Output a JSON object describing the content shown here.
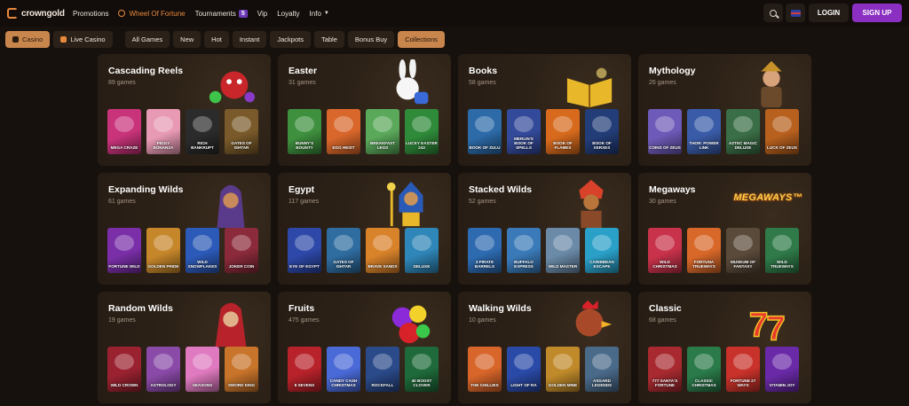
{
  "brand": {
    "name": "crowngold",
    "accent": "#e8893c"
  },
  "nav": {
    "items": [
      {
        "label": "Promotions"
      },
      {
        "label": "Wheel Of Fortune",
        "icon": "wheel-icon"
      },
      {
        "label": "Tournaments",
        "badge": "5"
      },
      {
        "label": "Vip"
      },
      {
        "label": "Loyalty"
      },
      {
        "label": "Info",
        "icon": "chevron-down-icon"
      }
    ]
  },
  "header_actions": {
    "login": "LOGIN",
    "signup": "SIGN UP",
    "signup_color": "#8a2fc2"
  },
  "filters": {
    "main": [
      {
        "label": "Casino",
        "active": true
      },
      {
        "label": "Live Casino",
        "active": false
      }
    ],
    "categories": [
      "All Games",
      "New",
      "Hot",
      "Instant",
      "Jackpots",
      "Table",
      "Bonus Buy",
      "Collections"
    ],
    "active_category": "Collections"
  },
  "collections": [
    {
      "title": "Cascading Reels",
      "count": "89 games",
      "art": "red-dragon",
      "games": [
        {
          "name": "MEGA CRAZE",
          "color": "#c9337a"
        },
        {
          "name": "PIGGY BONANZA",
          "color": "#e89ab4"
        },
        {
          "name": "RICH BANKRUPT",
          "color": "#2b2b2b"
        },
        {
          "name": "GATES OF ISHTAR",
          "color": "#7a5a2a"
        }
      ]
    },
    {
      "title": "Easter",
      "count": "31 games",
      "art": "white-bunny",
      "games": [
        {
          "name": "BUNNY'S BOUNTY",
          "color": "#3e8f3e"
        },
        {
          "name": "EGG HEIST",
          "color": "#d9672b"
        },
        {
          "name": "BREAKFAST LEGS",
          "color": "#5aa85a"
        },
        {
          "name": "LUCKY EASTER 243",
          "color": "#2f8a3a"
        }
      ]
    },
    {
      "title": "Books",
      "count": "58 games",
      "art": "golden-book",
      "games": [
        {
          "name": "BOOK OF ZULU",
          "color": "#2c6aa8"
        },
        {
          "name": "MERLIN'S BOOK OF SPELLS",
          "color": "#334a9a"
        },
        {
          "name": "BOOK OF FLAMES",
          "color": "#d76a1d"
        },
        {
          "name": "BOOK OF XERXES",
          "color": "#233d78"
        }
      ]
    },
    {
      "title": "Mythology",
      "count": "26 games",
      "art": "greek-warrior",
      "games": [
        {
          "name": "COINS OF ZEUS",
          "color": "#6e5ab8"
        },
        {
          "name": "THOR: POWER LINK",
          "color": "#3a5ca8"
        },
        {
          "name": "AZTEC MAGIC DELUXE",
          "color": "#3a6e46"
        },
        {
          "name": "LUCK OF ZEUS",
          "color": "#b8601e"
        }
      ]
    },
    {
      "title": "Expanding Wilds",
      "count": "61 games",
      "art": "hooded-woman",
      "games": [
        {
          "name": "FORTUNE WILD",
          "color": "#7a2fa8"
        },
        {
          "name": "GOLDEN PRIDE",
          "color": "#c6862a"
        },
        {
          "name": "WILD SNOWFLAKES",
          "color": "#2c5ab8"
        },
        {
          "name": "JOKER COIN",
          "color": "#8a2a3a"
        }
      ]
    },
    {
      "title": "Egypt",
      "count": "117 games",
      "art": "pharaoh",
      "games": [
        {
          "name": "EYE OF EGYPT",
          "color": "#2d48a8"
        },
        {
          "name": "GATES OF ISHTAR",
          "color": "#2f6ca0"
        },
        {
          "name": "BRAVE SANDS",
          "color": "#d8822a"
        },
        {
          "name": "DELUXE",
          "color": "#2f86b8"
        }
      ]
    },
    {
      "title": "Stacked Wilds",
      "count": "52 games",
      "art": "native-chief",
      "games": [
        {
          "name": "3 PIRATE BARRELS",
          "color": "#2d6ab0"
        },
        {
          "name": "BUFFALO EXPRESS",
          "color": "#3a7ab8"
        },
        {
          "name": "WILD MASTER",
          "color": "#6a8aa8"
        },
        {
          "name": "CARIBBEAN ESCAPE",
          "color": "#2aa0c8"
        }
      ]
    },
    {
      "title": "Megaways",
      "count": "30 games",
      "art": "megaways-logo",
      "games": [
        {
          "name": "WILD CHRISTMAS",
          "color": "#c8324a"
        },
        {
          "name": "FORTUNA TRUEWAYS",
          "color": "#d8682a"
        },
        {
          "name": "MUSEUM OF FANTASY",
          "color": "#5a4a3a"
        },
        {
          "name": "WILD TRUEWAYS",
          "color": "#2f7a48"
        }
      ]
    },
    {
      "title": "Random Wilds",
      "count": "19 games",
      "art": "red-hood",
      "games": [
        {
          "name": "WILD CROWN",
          "color": "#9a2230"
        },
        {
          "name": "ASTROLOGY",
          "color": "#8a4aa8"
        },
        {
          "name": "SEASONS",
          "color": "#e07ac0"
        },
        {
          "name": "SWORD KING",
          "color": "#c8742a"
        }
      ]
    },
    {
      "title": "Fruits",
      "count": "475 games",
      "art": "fruit-bowl",
      "games": [
        {
          "name": "8 SEVENS",
          "color": "#b8222a"
        },
        {
          "name": "CANDY CASH CHRISTMAS",
          "color": "#4a6ad8"
        },
        {
          "name": "ROCKFALL",
          "color": "#2a4a8a"
        },
        {
          "name": "40 BOOST CLOVER",
          "color": "#1e6a3a"
        }
      ]
    },
    {
      "title": "Walking Wilds",
      "count": "10 games",
      "art": "rooster",
      "games": [
        {
          "name": "THE CHILLIES",
          "color": "#d8652a"
        },
        {
          "name": "LIGHT OF RA",
          "color": "#2a4aa8"
        },
        {
          "name": "GOLDEN MINE",
          "color": "#c08a2a"
        },
        {
          "name": "ASGARD LEGENDS",
          "color": "#4a6a8a"
        }
      ]
    },
    {
      "title": "Classic",
      "count": "68 games",
      "art": "lucky-sevens",
      "games": [
        {
          "name": "777 SANTA'S FORTUNE",
          "color": "#a82a30"
        },
        {
          "name": "CLASSIC CHRISTMAS",
          "color": "#2a7a4a"
        },
        {
          "name": "FORTUNE 27 WAYS",
          "color": "#c8322a"
        },
        {
          "name": "VITAMIN JOY",
          "color": "#6a2aa8"
        }
      ]
    }
  ]
}
